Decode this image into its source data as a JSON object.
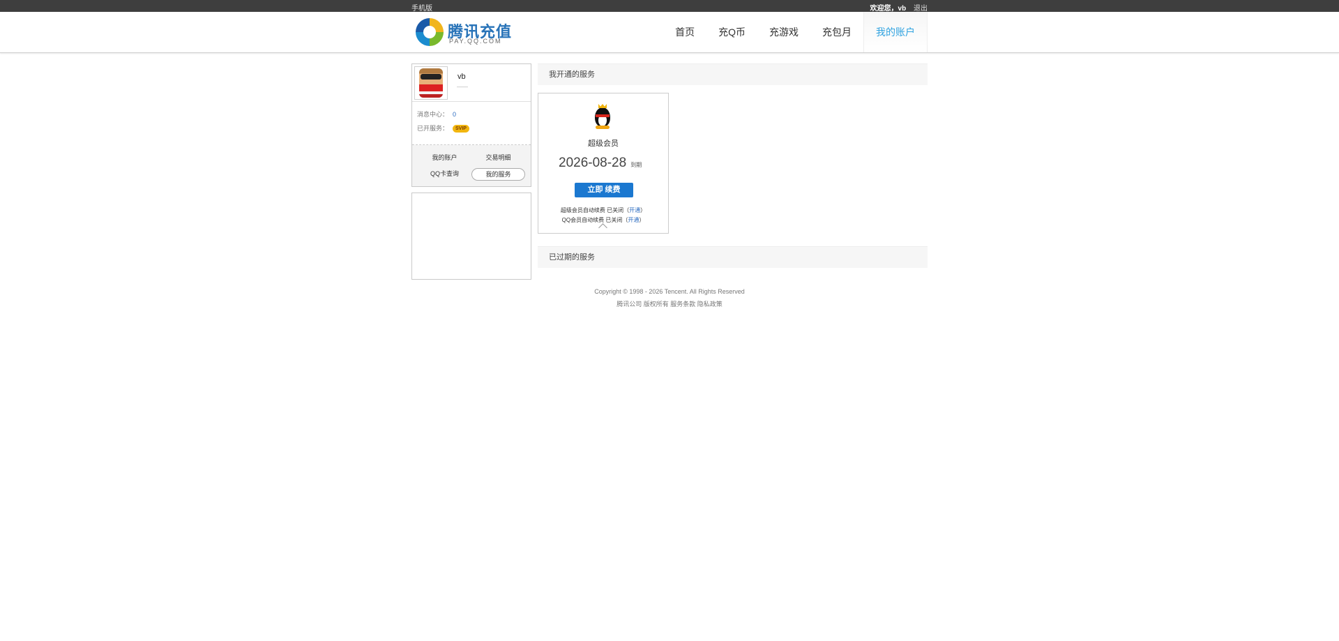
{
  "topbar": {
    "mobile": "手机版",
    "welcome": "欢迎您，vb",
    "logout": "退出"
  },
  "header": {
    "logo_title": "腾讯充值",
    "logo_sub": "PAY.QQ.COM",
    "nav": [
      {
        "label": "首页"
      },
      {
        "label": "充Q币"
      },
      {
        "label": "充游戏"
      },
      {
        "label": "充包月"
      },
      {
        "label": "我的账户"
      }
    ]
  },
  "profile": {
    "username": "vb",
    "sub": "——",
    "message_label": "消息中心：",
    "message_count": "0",
    "services_label": "已开服务：",
    "svip_badge": "SVIP",
    "links": [
      {
        "label": "我的账户"
      },
      {
        "label": "交易明细"
      },
      {
        "label": "QQ卡查询"
      },
      {
        "label": "我的服务"
      }
    ]
  },
  "main": {
    "active_title": "我开通的服务",
    "service": {
      "name": "超级会员",
      "expiry_date": "2026-08-28",
      "expiry_suffix": "到期",
      "renew_button": "立即 续费",
      "auto1_text": "超级会员自动续费 已关闭（",
      "auto1_link": "开通",
      "auto2_text": "QQ会员自动续费 已关闭（",
      "auto2_link": "开通",
      "close_paren": "）"
    },
    "expired_title": "已过期的服务"
  },
  "footer": {
    "copyright": "Copyright © 1998 - 2026 Tencent. All Rights Reserved",
    "links": "腾讯公司 版权所有 服务条款 隐私政策"
  }
}
